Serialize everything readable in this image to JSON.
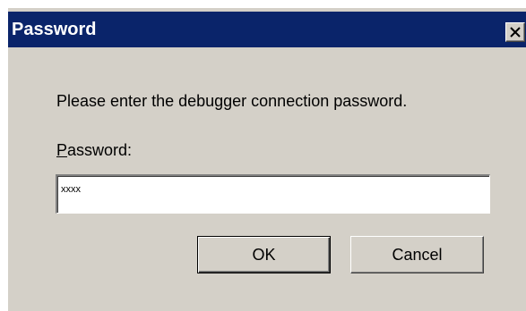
{
  "window": {
    "title": "Password",
    "close_icon": "close-icon"
  },
  "dialog": {
    "prompt": "Please enter the debugger connection password.",
    "password_label_accel": "P",
    "password_label_rest": "assword:",
    "password_value": "xxxx"
  },
  "buttons": {
    "ok_label": "OK",
    "cancel_label": "Cancel"
  },
  "colors": {
    "titlebar": "#0a246a",
    "face": "#d4d0c8"
  }
}
